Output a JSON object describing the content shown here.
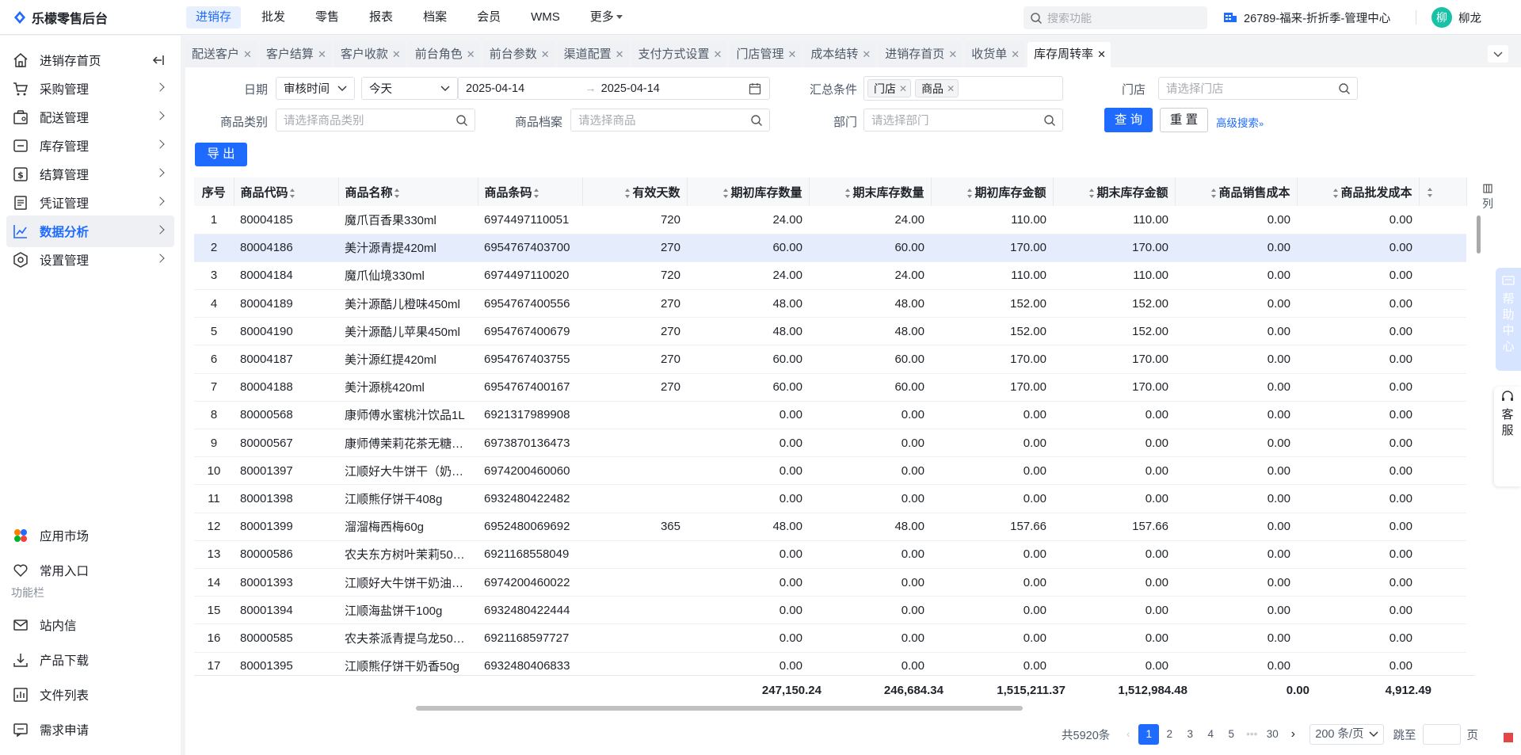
{
  "app": {
    "title": "乐檬零售后台"
  },
  "topnav": [
    "进销存",
    "批发",
    "零售",
    "报表",
    "档案",
    "会员",
    "WMS",
    "更多"
  ],
  "topnav_active": 0,
  "search": {
    "placeholder": "搜索功能"
  },
  "store": {
    "name": "26789-福来-折折季-管理中心"
  },
  "user": {
    "avatar_char": "柳",
    "name": "柳龙"
  },
  "sidebar": {
    "items": [
      {
        "label": "进销存首页",
        "icon": "home-icon"
      },
      {
        "label": "采购管理",
        "icon": "cart-icon"
      },
      {
        "label": "配送管理",
        "icon": "box-icon"
      },
      {
        "label": "库存管理",
        "icon": "inventory-icon"
      },
      {
        "label": "结算管理",
        "icon": "dollar-icon"
      },
      {
        "label": "凭证管理",
        "icon": "document-icon"
      },
      {
        "label": "数据分析",
        "icon": "chart-icon"
      },
      {
        "label": "设置管理",
        "icon": "settings-icon"
      }
    ],
    "active_index": 6,
    "bottom": {
      "app_market": "应用市场",
      "favorites": "常用入口",
      "section_label": "功能栏",
      "messages": "站内信",
      "downloads": "产品下载",
      "files": "文件列表",
      "requests": "需求申请"
    }
  },
  "tabs": [
    "配送客户",
    "客户结算",
    "客户收款",
    "前台角色",
    "前台参数",
    "渠道配置",
    "支付方式设置",
    "门店管理",
    "成本结转",
    "进销存首页",
    "收货单",
    "库存周转率"
  ],
  "active_tab": 11,
  "filters": {
    "date_label": "日期",
    "date_type": "审核时间",
    "date_preset": "今天",
    "date_start": "2025-04-14",
    "date_end": "2025-04-14",
    "summary_label": "汇总条件",
    "summary_tags": [
      "门店",
      "商品"
    ],
    "store_label": "门店",
    "store_placeholder": "请选择门店",
    "category_label": "商品类别",
    "category_placeholder": "请选择商品类别",
    "product_label": "商品档案",
    "product_placeholder": "请选择商品",
    "dept_label": "部门",
    "dept_placeholder": "请选择部门",
    "query_btn": "查 询",
    "reset_btn": "重 置",
    "advanced": "高级搜索"
  },
  "export_btn": "导 出",
  "table": {
    "columns": [
      "序号",
      "商品代码",
      "商品名称",
      "商品条码",
      "有效天数",
      "期初库存数量",
      "期末库存数量",
      "期初库存金额",
      "期末库存金额",
      "商品销售成本",
      "商品批发成本"
    ],
    "rows": [
      [
        "1",
        "80004185",
        "魔爪百香果330ml",
        "6974497110051",
        "720",
        "24.00",
        "24.00",
        "110.00",
        "110.00",
        "0.00",
        "0.00"
      ],
      [
        "2",
        "80004186",
        "美汁源青提420ml",
        "6954767403700",
        "270",
        "60.00",
        "60.00",
        "170.00",
        "170.00",
        "0.00",
        "0.00"
      ],
      [
        "3",
        "80004184",
        "魔爪仙境330ml",
        "6974497110020",
        "720",
        "24.00",
        "24.00",
        "110.00",
        "110.00",
        "0.00",
        "0.00"
      ],
      [
        "4",
        "80004189",
        "美汁源酷儿橙味450ml",
        "6954767400556",
        "270",
        "48.00",
        "48.00",
        "152.00",
        "152.00",
        "0.00",
        "0.00"
      ],
      [
        "5",
        "80004190",
        "美汁源酷儿苹果450ml",
        "6954767400679",
        "270",
        "48.00",
        "48.00",
        "152.00",
        "152.00",
        "0.00",
        "0.00"
      ],
      [
        "6",
        "80004187",
        "美汁源红提420ml",
        "6954767403755",
        "270",
        "60.00",
        "60.00",
        "170.00",
        "170.00",
        "0.00",
        "0.00"
      ],
      [
        "7",
        "80004188",
        "美汁源桃420ml",
        "6954767400167",
        "270",
        "60.00",
        "60.00",
        "170.00",
        "170.00",
        "0.00",
        "0.00"
      ],
      [
        "8",
        "80000568",
        "康师傅水蜜桃汁饮品1L",
        "6921317989908",
        "",
        "0.00",
        "0.00",
        "0.00",
        "0.00",
        "0.00",
        "0.00"
      ],
      [
        "9",
        "80000567",
        "康师傅茉莉花茶无糖…",
        "6973870136473",
        "",
        "0.00",
        "0.00",
        "0.00",
        "0.00",
        "0.00",
        "0.00"
      ],
      [
        "10",
        "80001397",
        "江顺好大牛饼干（奶…",
        "6974200460060",
        "",
        "0.00",
        "0.00",
        "0.00",
        "0.00",
        "0.00",
        "0.00"
      ],
      [
        "11",
        "80001398",
        "江顺熊仔饼干408g",
        "6932480422482",
        "",
        "0.00",
        "0.00",
        "0.00",
        "0.00",
        "0.00",
        "0.00"
      ],
      [
        "12",
        "80001399",
        "溜溜梅西梅60g",
        "6952480069692",
        "365",
        "48.00",
        "48.00",
        "157.66",
        "157.66",
        "0.00",
        "0.00"
      ],
      [
        "13",
        "80000586",
        "农夫东方树叶茉莉50…",
        "6921168558049",
        "",
        "0.00",
        "0.00",
        "0.00",
        "0.00",
        "0.00",
        "0.00"
      ],
      [
        "14",
        "80001393",
        "江顺好大牛饼干奶油…",
        "6974200460022",
        "",
        "0.00",
        "0.00",
        "0.00",
        "0.00",
        "0.00",
        "0.00"
      ],
      [
        "15",
        "80001394",
        "江顺海盐饼干100g",
        "6932480422444",
        "",
        "0.00",
        "0.00",
        "0.00",
        "0.00",
        "0.00",
        "0.00"
      ],
      [
        "16",
        "80000585",
        "农夫茶派青提乌龙50…",
        "6921168597727",
        "",
        "0.00",
        "0.00",
        "0.00",
        "0.00",
        "0.00",
        "0.00"
      ],
      [
        "17",
        "80001395",
        "江顺熊仔饼干奶香50g",
        "6932480406833",
        "",
        "0.00",
        "0.00",
        "0.00",
        "0.00",
        "0.00",
        "0.00"
      ]
    ],
    "selected_row": 1,
    "totals": [
      "247,150.24",
      "246,684.34",
      "1,515,211.37",
      "1,512,984.48",
      "0.00",
      "4,912.49"
    ],
    "col_settings": "列"
  },
  "pagination": {
    "total": "共5920条",
    "pages": [
      "1",
      "2",
      "3",
      "4",
      "5",
      "•••",
      "30"
    ],
    "current": "1",
    "page_size": "200 条/页",
    "jump_label": "跳至",
    "page_unit": "页"
  },
  "floating": {
    "help": "帮助中心",
    "service": "客服"
  },
  "colors": {
    "primary": "#1f6bff",
    "selected_row": "#e5ecfb",
    "avatar": "#17c2a6"
  }
}
